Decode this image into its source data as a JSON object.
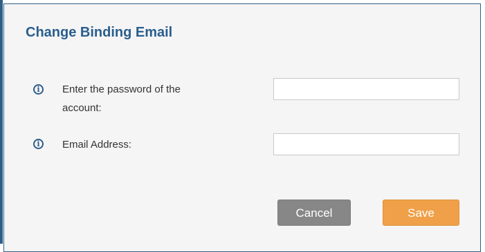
{
  "dialog": {
    "title": "Change Binding Email",
    "fields": [
      {
        "label_line1": "Enter the password of the",
        "label_line2": "account:",
        "value": "",
        "placeholder": ""
      },
      {
        "label_line1": "Email Address:",
        "value": "",
        "placeholder": ""
      }
    ],
    "cancel_label": "Cancel",
    "save_label": "Save",
    "icon": "info-circle-icon"
  },
  "colors": {
    "title": "#2a5e8e",
    "border": "#2f5f86",
    "cancel": "#878787",
    "save": "#f0a048"
  }
}
